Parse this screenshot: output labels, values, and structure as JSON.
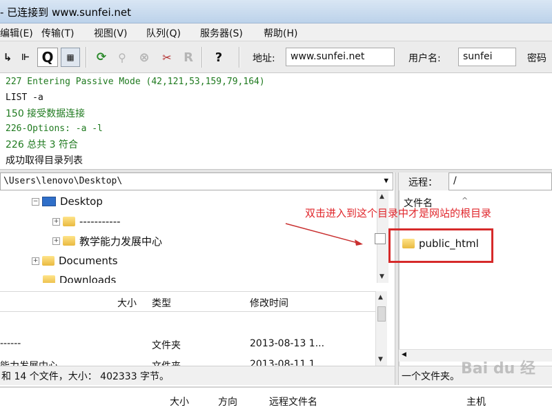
{
  "window": {
    "title": "- 已连接到 www.sunfei.net"
  },
  "menu": [
    "编辑(E)",
    "传输(T)",
    "视图(V)",
    "队列(Q)",
    "服务器(S)",
    "帮助(H)"
  ],
  "toolbar": {
    "address_label": "地址:",
    "address_value": "www.sunfei.net",
    "username_label": "用户名:",
    "username_value": "sunfei",
    "password_label": "密码"
  },
  "log": [
    {
      "text": "227 Entering Passive Mode (42,121,53,159,79,164)",
      "color": "green"
    },
    {
      "text": "LIST -a",
      "color": "black"
    },
    {
      "text": "150 接受数据连接",
      "color": "green"
    },
    {
      "text": "226-Options: -a -l",
      "color": "green"
    },
    {
      "text": "226 总共 3 符合",
      "color": "green"
    },
    {
      "text": "成功取得目录列表",
      "color": "black"
    }
  ],
  "local": {
    "path": "\\Users\\lenovo\\Desktop\\",
    "tree": [
      {
        "label": "Desktop",
        "icon": "monitor-icon"
      },
      {
        "label": "-----------",
        "icon": "folder-icon"
      },
      {
        "label": "教学能力发展中心",
        "icon": "folder-icon"
      },
      {
        "label": "Documents",
        "icon": "folder-icon"
      },
      {
        "label": "Downloads",
        "icon": "folder-icon"
      }
    ],
    "columns": {
      "size": "大小",
      "type": "类型",
      "modified": "修改时间"
    },
    "rows": [
      {
        "name": "------",
        "type": "文件夹",
        "modified": "2013-08-13 1..."
      },
      {
        "name": "能力发展中心",
        "type": "文件夹",
        "modified": "2013-08-11 1..."
      }
    ],
    "status": "和 14 个文件，大小： 402333 字节。"
  },
  "remote": {
    "path_label": "远程：",
    "path_value": "/",
    "column_name": "文件名",
    "items": [
      {
        "label": "public_html",
        "icon": "folder-icon"
      }
    ],
    "status": "一个文件夹。"
  },
  "annotation": "双击进入到这个目录中才是网站的根目录",
  "queue": {
    "size": "大小",
    "direction": "方向",
    "remote_file": "远程文件名",
    "host": "主机"
  },
  "watermark": "Bai du 经"
}
